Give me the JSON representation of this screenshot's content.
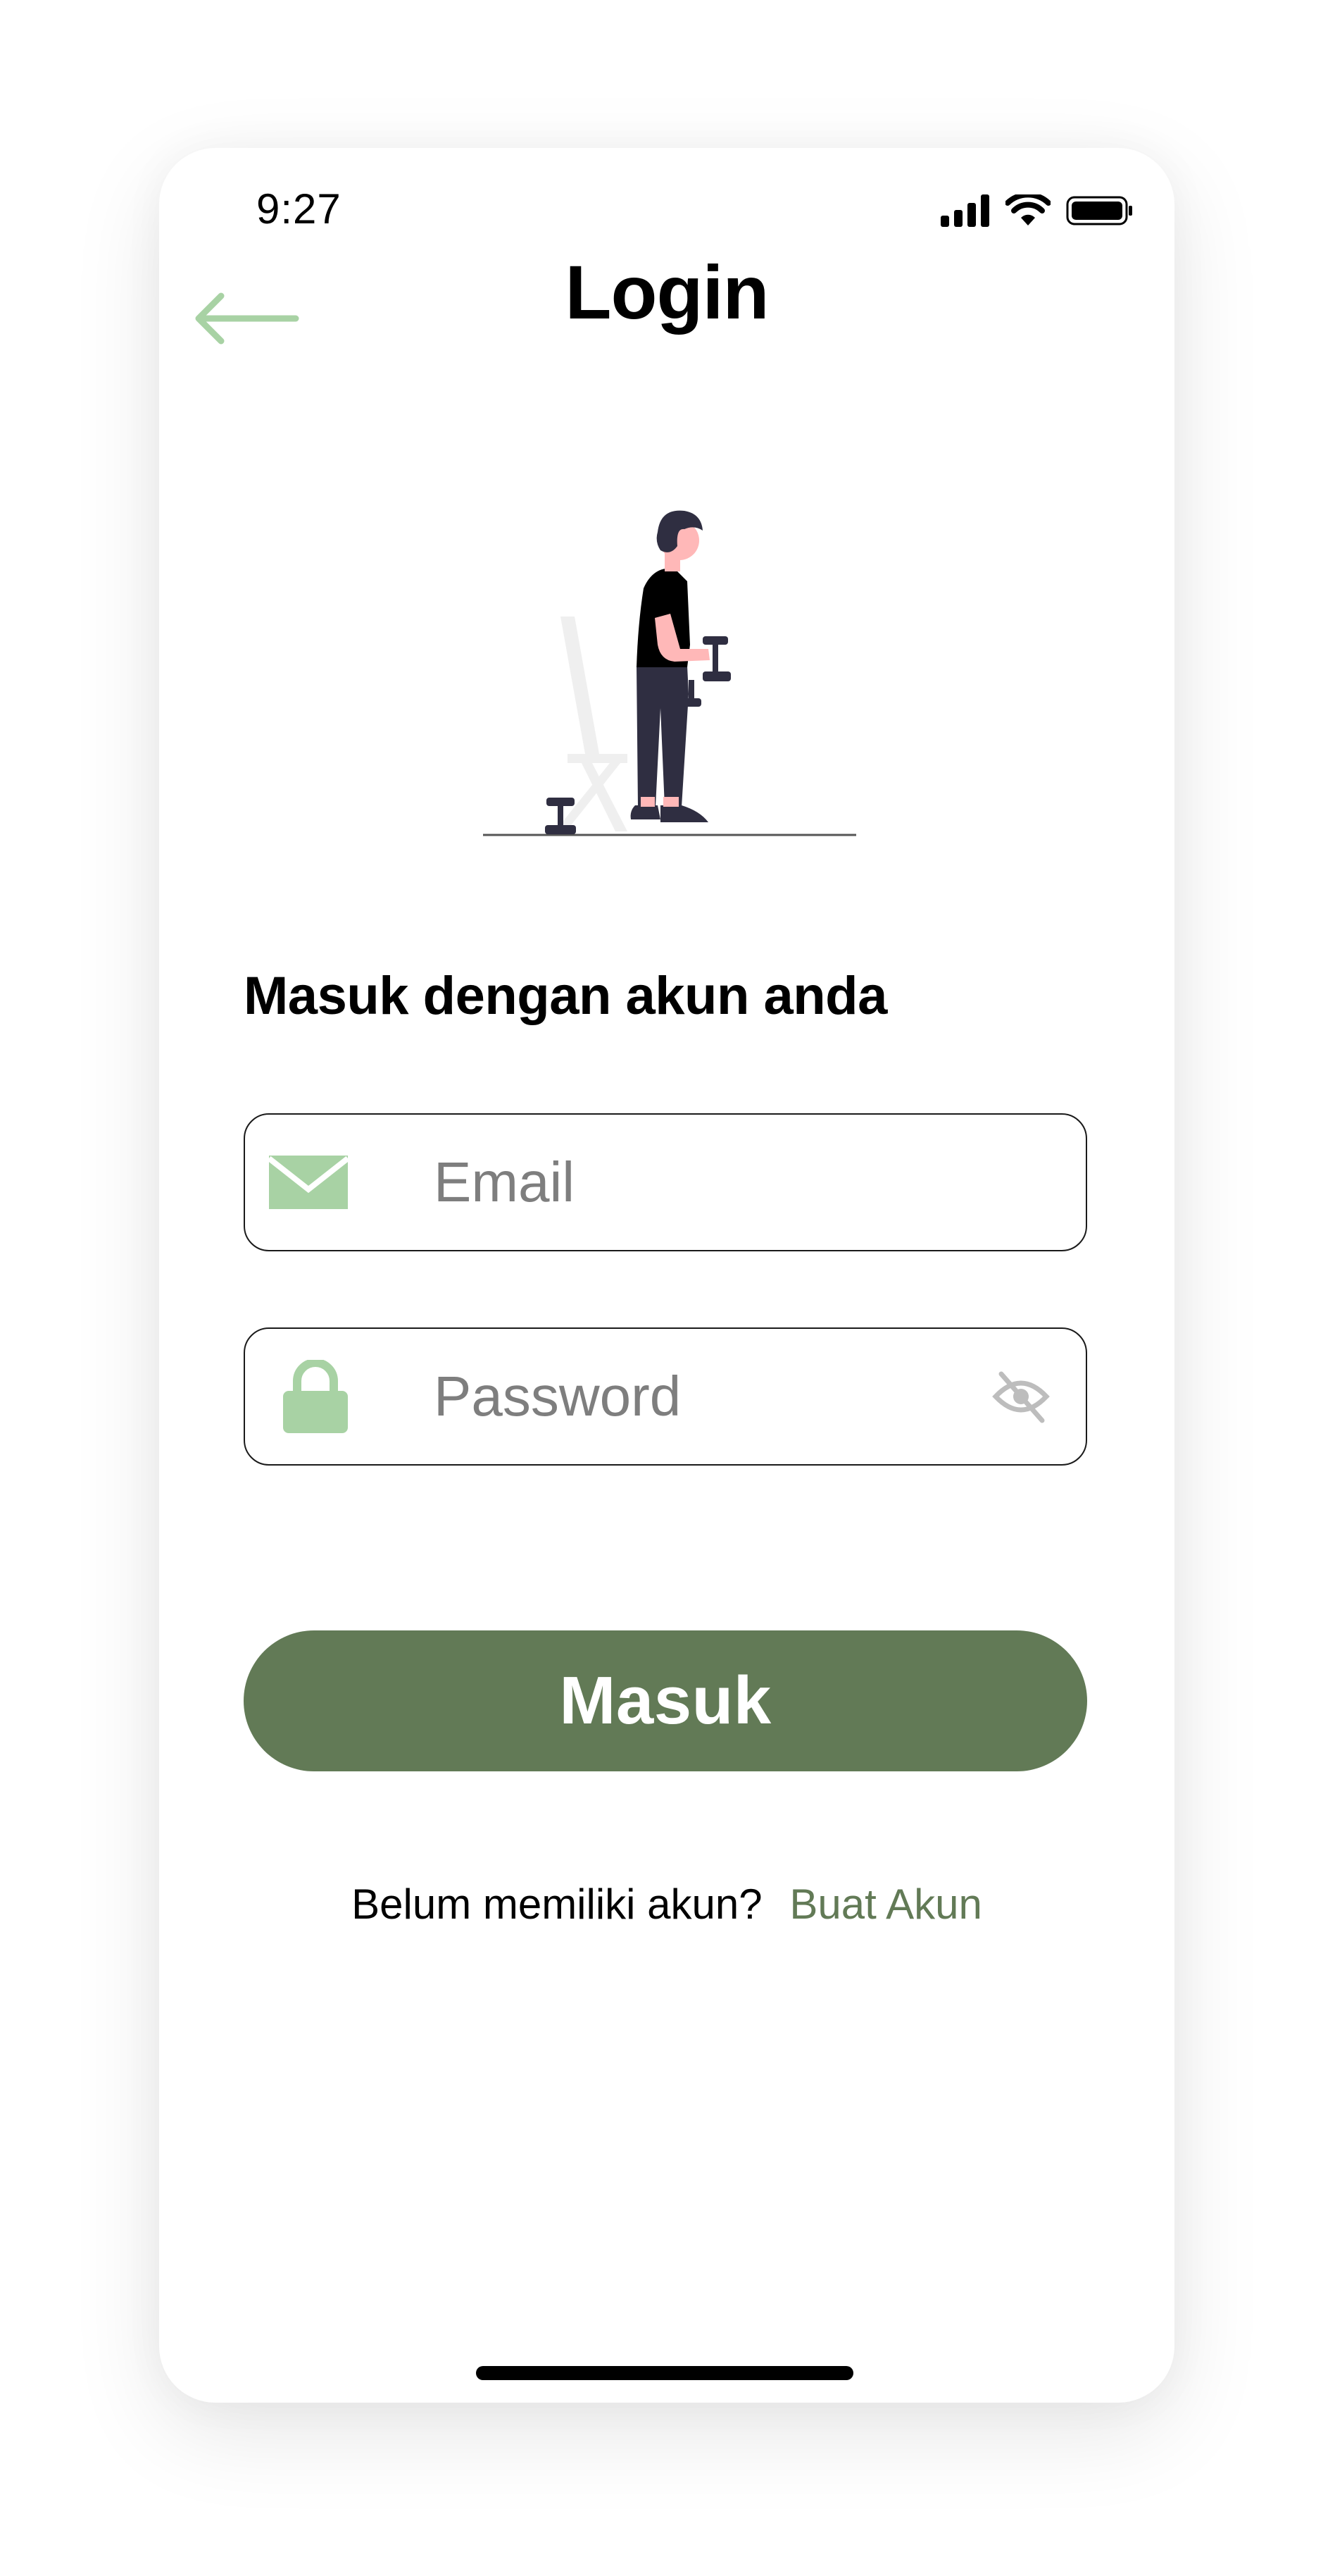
{
  "status_bar": {
    "time": "9:27"
  },
  "header": {
    "title": "Login",
    "back_icon": "arrow-left-icon"
  },
  "illustration": {
    "icon": "person-with-dumbbells-illustration"
  },
  "form": {
    "heading": "Masuk dengan akun anda",
    "email": {
      "placeholder": "Email",
      "value": "",
      "icon": "envelope-icon"
    },
    "password": {
      "placeholder": "Password",
      "value": "",
      "icon": "lock-icon",
      "visibility_icon": "eye-off-icon"
    },
    "submit_label": "Masuk"
  },
  "signup": {
    "prompt": "Belum memiliki akun?",
    "link_label": "Buat Akun"
  },
  "colors": {
    "primary": "#627a56",
    "accent_light": "#a8d2a4",
    "text": "#000000",
    "placeholder": "#7e7e7e"
  }
}
